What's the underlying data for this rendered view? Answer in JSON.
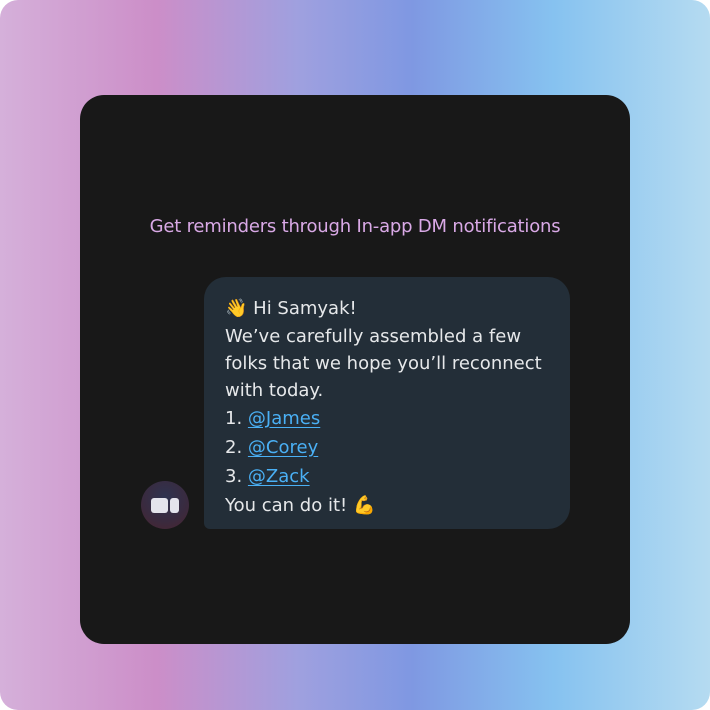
{
  "heading": "Get reminders through In-app DM notifications",
  "message": {
    "greeting_emoji": "👋",
    "greeting": "Hi Samyak!",
    "body_lines": [
      "We’ve carefully assembled a few",
      "folks that we hope you’ll reconnect",
      "with today."
    ],
    "list": [
      {
        "number": "1.",
        "mention": "@James"
      },
      {
        "number": "2.",
        "mention": "@Corey"
      },
      {
        "number": "3.",
        "mention": "@Zack"
      }
    ],
    "closing": "You can do it!",
    "closing_emoji": "💪"
  },
  "colors": {
    "heading": "#d9a9e6",
    "mention": "#4ab0f5",
    "bubble": "#232e38",
    "card": "#181818"
  },
  "icons": {
    "avatar": "bot-avatar-icon"
  }
}
